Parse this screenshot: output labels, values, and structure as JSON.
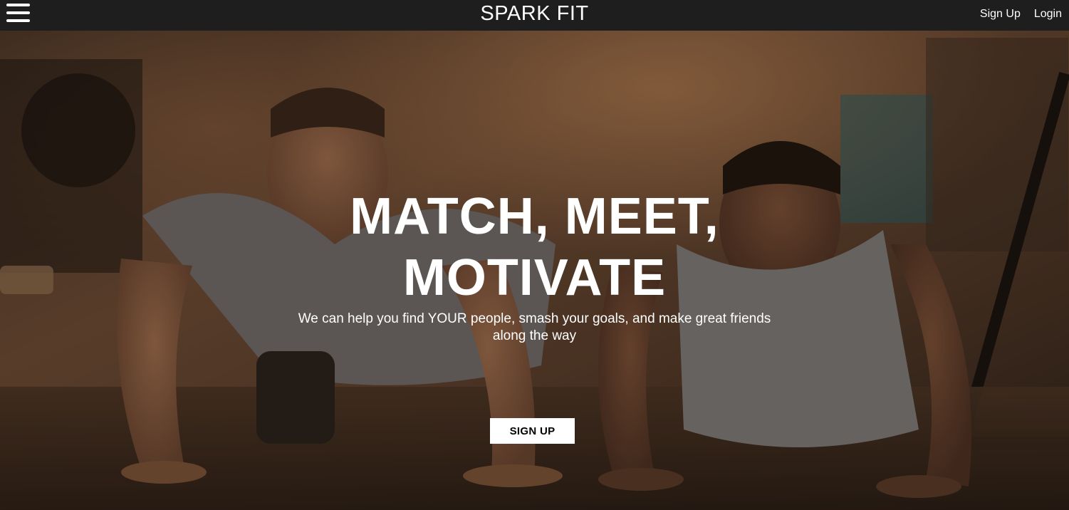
{
  "navbar": {
    "brand": "SPARK FIT",
    "links": [
      "Sign Up",
      "Login"
    ]
  },
  "hero": {
    "headline_line1": "MATCH, MEET,",
    "headline_line2": "MOTIVATE",
    "subtext_line1": "We can help you find YOUR people, smash your goals, and make great friends",
    "subtext_line2": "along the way",
    "cta_label": "SIGN UP"
  },
  "colors": {
    "navbar_bg": "#1e1e1e",
    "hero_text": "#ffffff",
    "cta_bg": "#ffffff",
    "cta_text": "#000000"
  },
  "icons": [
    "hamburger-menu-icon"
  ]
}
